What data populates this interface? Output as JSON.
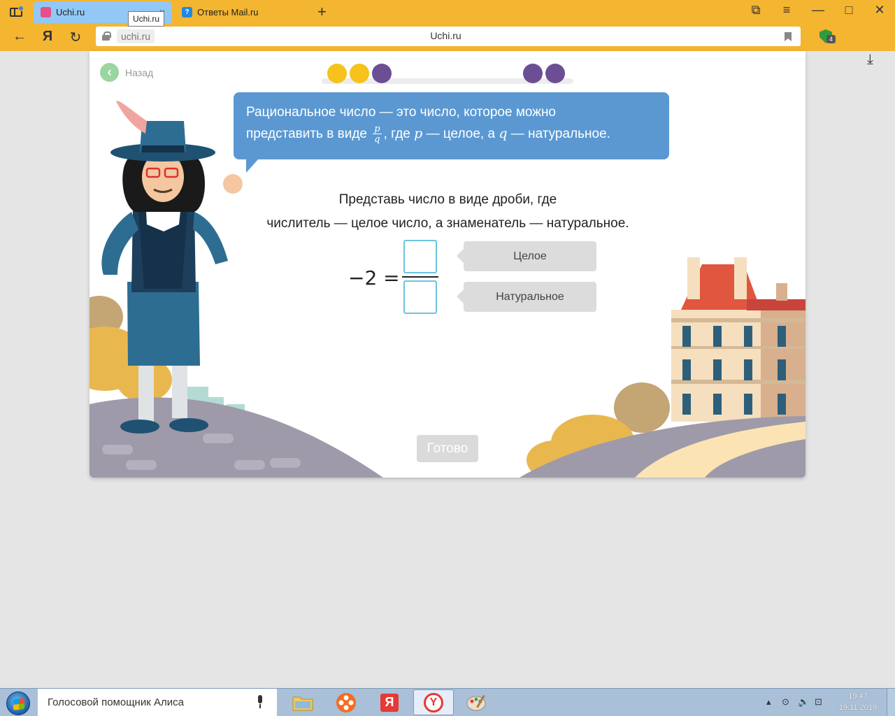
{
  "browser": {
    "tabs": [
      {
        "title": "Uchi.ru",
        "active": true
      },
      {
        "title": "Ответы Mail.ru",
        "active": false
      }
    ],
    "tooltip": "Uchi.ru",
    "close_glyph": "×",
    "new_tab_glyph": "+",
    "domain": "uchi.ru",
    "page_title": "Uchi.ru",
    "protect_badge": "4",
    "icons": {
      "back": "←",
      "yandex": "Я",
      "reload": "↻",
      "download": "⤓",
      "sync": "⧉",
      "menu": "≡",
      "minimize": "—",
      "maximize": "□",
      "close": "✕"
    }
  },
  "lesson": {
    "back_label": "Назад",
    "back_glyph": "‹",
    "progress_dots": [
      {
        "color": "#f6c21b"
      },
      {
        "color": "#f6c21b"
      },
      {
        "color": "#6b4e93"
      },
      {
        "color": "#6b4e93"
      },
      {
        "color": "#6b4e93"
      }
    ],
    "bubble": {
      "line1": "Рациональное число — это число, которое можно",
      "line2_start": "представить в виде",
      "frac_num": "p",
      "frac_den": "q",
      "line2_mid1": ", где",
      "var_p": "p",
      "line2_mid2": "— целое, а",
      "var_q": "q",
      "line2_end": "— натуральное."
    },
    "task_line1": "Представь число в виде дроби, где",
    "task_line2": "числитель — целое число, а знаменатель — натуральное.",
    "equation_left": "−2 =",
    "hint_top": "Целое",
    "hint_bottom": "Натуральное",
    "done_label": "Готово"
  },
  "taskbar": {
    "alice_label": "Голосовой помощник Алиса",
    "yandex_app_label": "Я",
    "browser_app_label": "Y",
    "tray_arrow": "▴",
    "tray_icons": [
      "⊙",
      "🔊",
      "⊡"
    ],
    "time": "19:47",
    "date": "19.11.2019"
  }
}
